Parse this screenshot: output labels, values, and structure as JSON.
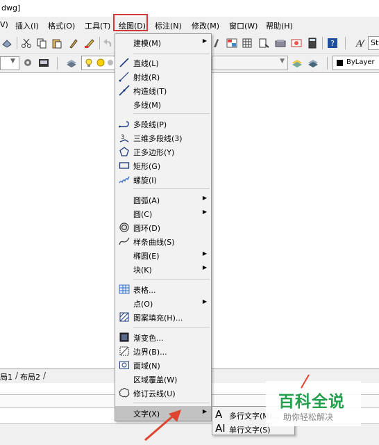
{
  "window": {
    "title_fragment": "dwg]"
  },
  "menubar": {
    "items": [
      {
        "label": "V)"
      },
      {
        "label": "插入(I)"
      },
      {
        "label": "格式(O)"
      },
      {
        "label": "工具(T)"
      },
      {
        "label": "绘图(D)"
      },
      {
        "label": "标注(N)"
      },
      {
        "label": "修改(M)"
      },
      {
        "label": "窗口(W)"
      },
      {
        "label": "帮助(H)"
      }
    ]
  },
  "toolbar": {
    "text_style_fragment": "St",
    "color_value": "ByLayer"
  },
  "layout_tabs": [
    "局1",
    "布局2"
  ],
  "draw_menu": {
    "items": [
      {
        "label": "建模(M)",
        "submenu": true,
        "icon": ""
      },
      {
        "label": "直线(L)",
        "icon": "line-icon"
      },
      {
        "label": "射线(R)",
        "icon": "ray-icon"
      },
      {
        "label": "构造线(T)",
        "icon": "construction-line-icon"
      },
      {
        "label": "多线(M)",
        "icon": ""
      },
      {
        "label": "多段线(P)",
        "icon": "polyline-icon"
      },
      {
        "label": "三维多段线(3)",
        "icon": "3d-polyline-icon"
      },
      {
        "label": "正多边形(Y)",
        "icon": "polygon-icon"
      },
      {
        "label": "矩形(G)",
        "icon": "rectangle-icon"
      },
      {
        "label": "螺旋(I)",
        "icon": "helix-icon"
      },
      {
        "label": "圆弧(A)",
        "submenu": true,
        "icon": ""
      },
      {
        "label": "圆(C)",
        "submenu": true,
        "icon": ""
      },
      {
        "label": "圆环(D)",
        "icon": "donut-icon"
      },
      {
        "label": "样条曲线(S)",
        "icon": "spline-icon"
      },
      {
        "label": "椭圆(E)",
        "submenu": true,
        "icon": ""
      },
      {
        "label": "块(K)",
        "submenu": true,
        "icon": ""
      },
      {
        "label": "表格...",
        "icon": "table-icon"
      },
      {
        "label": "点(O)",
        "submenu": true,
        "icon": ""
      },
      {
        "label": "图案填充(H)...",
        "icon": "hatch-icon"
      },
      {
        "label": "渐变色...",
        "icon": "gradient-icon"
      },
      {
        "label": "边界(B)...",
        "icon": "boundary-icon"
      },
      {
        "label": "面域(N)",
        "icon": "region-icon"
      },
      {
        "label": "区域覆盖(W)",
        "icon": ""
      },
      {
        "label": "修订云线(U)",
        "icon": "revcloud-icon"
      },
      {
        "label": "文字(X)",
        "submenu": true,
        "icon": "",
        "highlighted": true
      }
    ]
  },
  "text_submenu": {
    "items": [
      {
        "label": "多行文字(M)...",
        "icon": "A"
      },
      {
        "label": "单行文字(S)",
        "icon": "AI"
      }
    ]
  },
  "watermark": {
    "title": "百科全说",
    "subtitle": "助你轻松解决"
  },
  "colors": {
    "highlight_box": "#d23b3b",
    "arrow": "#e0442e",
    "watermark_green": "#22a04b"
  }
}
